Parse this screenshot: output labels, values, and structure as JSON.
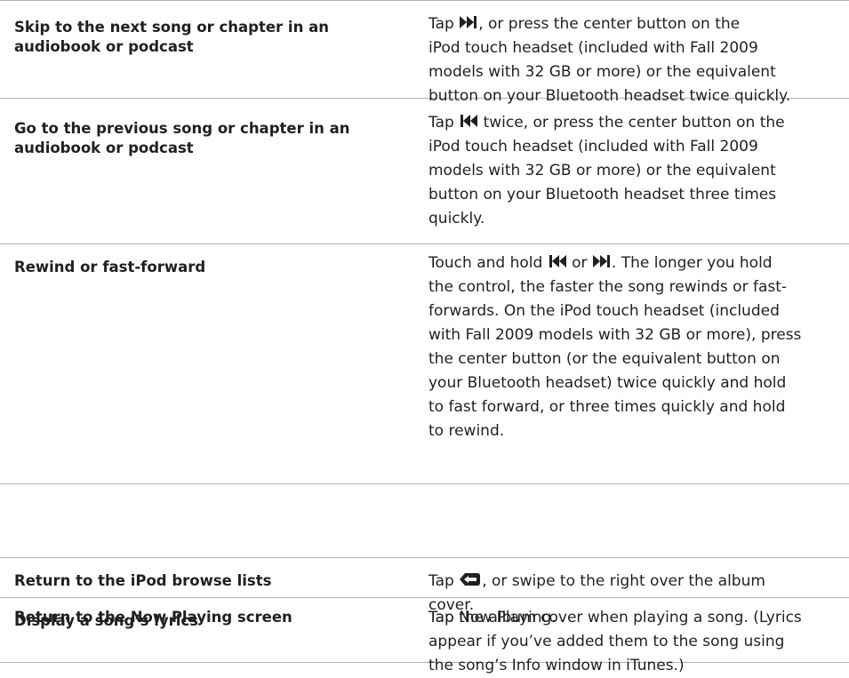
{
  "rows": [
    {
      "task": [
        "Skip to the next song or chapter in an",
        "audiobook or podcast"
      ],
      "howto": [
        [
          "Tap ",
          "{icon:next}",
          ", or press the center button on the"
        ],
        [
          "iPod touch headset (included with Fall 2009"
        ],
        [
          "models with 32 GB or more) or the equivalent"
        ],
        [
          "button on your Bluetooth headset twice quickly."
        ]
      ]
    },
    {
      "task": [
        "Go to the previous song or chapter in an",
        "audiobook or podcast"
      ],
      "howto": [
        [
          "Tap ",
          "{icon:prev}",
          " twice, or press the center button on the"
        ],
        [
          "iPod touch headset (included with Fall 2009"
        ],
        [
          "models with 32 GB or more) or the equivalent"
        ],
        [
          "button on your Bluetooth headset three times"
        ],
        [
          "quickly."
        ]
      ]
    },
    {
      "task": [
        "Rewind or fast-forward"
      ],
      "howto": [
        [
          "Touch and hold ",
          "{icon:prev}",
          " or ",
          "{icon:next}",
          ". The longer you hold"
        ],
        [
          "the control, the faster the song rewinds or fast-"
        ],
        [
          "forwards. On the iPod touch headset (included"
        ],
        [
          "with Fall 2009 models with 32 GB or more), press"
        ],
        [
          "the center button (or the equivalent button on"
        ],
        [
          "your Bluetooth headset) twice quickly and hold"
        ],
        [
          "to fast forward, or three times quickly and hold"
        ],
        [
          "to rewind."
        ]
      ]
    },
    {
      "task": [
        "Return to the iPod browse lists"
      ],
      "howto": [
        [
          "Tap ",
          "{icon:back}",
          ", or swipe to the right over the album"
        ],
        [
          "cover."
        ]
      ]
    },
    {
      "task": [
        "Return to the Now Playing screen"
      ],
      "howto": [
        [
          "Tap Now Playing."
        ]
      ]
    },
    {
      "task": [
        "Display a song’s lyrics"
      ],
      "howto": [
        [
          "Tap the album cover when playing a song. (Lyrics"
        ],
        [
          "appear if you’ve added them to the song using"
        ],
        [
          "the song’s Info window in iTunes.)"
        ]
      ]
    }
  ],
  "icons": {
    "next": "next-track-icon",
    "prev": "previous-track-icon",
    "back": "back-arrow-icon"
  },
  "colors": {
    "text": "#231f20",
    "rule": "#b2b2b2"
  }
}
